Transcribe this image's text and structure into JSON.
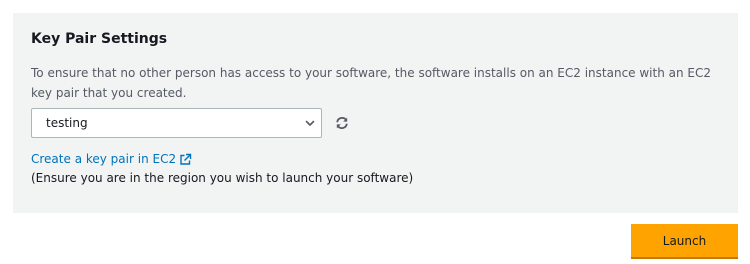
{
  "key_pair": {
    "title": "Key Pair Settings",
    "description": "To ensure that no other person has access to your software, the software installs on an EC2 instance with an EC2 key pair that you created.",
    "selected_key_pair": "testing",
    "create_link_label": "Create a key pair in EC2",
    "hint": "(Ensure you are in the region you wish to launch your software)"
  },
  "actions": {
    "launch_label": "Launch"
  },
  "colors": {
    "panel_background": "#f2f3f3",
    "link": "#0073bb",
    "primary_button": "#ffa300"
  },
  "icons": {
    "dropdown": "chevron-down-icon",
    "refresh": "refresh-icon",
    "external_link": "external-link-icon"
  }
}
